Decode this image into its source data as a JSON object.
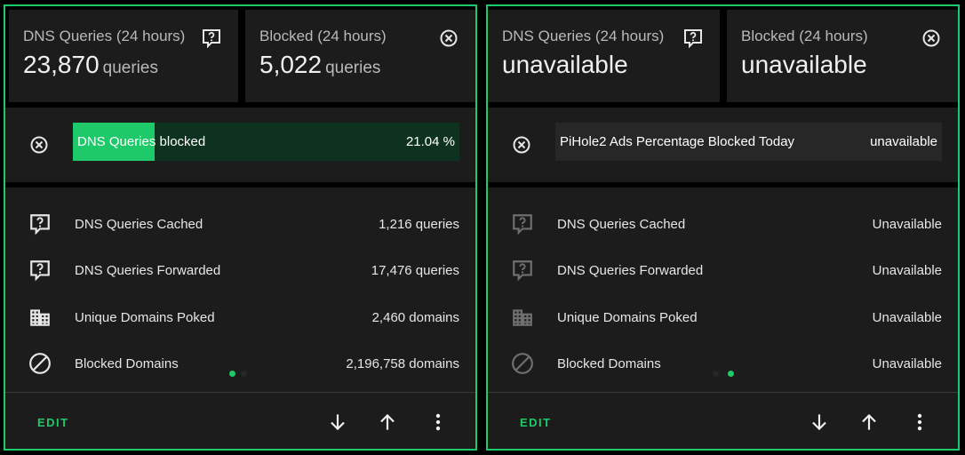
{
  "accent": "#1ec96a",
  "cards": [
    {
      "queries_label": "DNS Queries (24 hours)",
      "queries_value": "23,870",
      "queries_unit": "queries",
      "blocked_label": "Blocked (24 hours)",
      "blocked_value": "5,022",
      "blocked_unit": "queries",
      "bar_text": "DNS Queries blocked",
      "bar_value": "21.04 %",
      "bar_fraction": 0.2104,
      "rows": [
        {
          "label": "DNS Queries Cached",
          "value": "1,216 queries",
          "icon": "comment-question-icon"
        },
        {
          "label": "DNS Queries Forwarded",
          "value": "17,476 queries",
          "icon": "comment-question-icon"
        },
        {
          "label": "Unique Domains Poked",
          "value": "2,460 domains",
          "icon": "domain-icon"
        },
        {
          "label": "Blocked Domains",
          "value": "2,196,758 domains",
          "icon": "cancel-icon"
        }
      ],
      "active_page": 1,
      "edit_label": "EDIT"
    },
    {
      "queries_label": "DNS Queries (24 hours)",
      "queries_value": "unavailable",
      "blocked_label": "Blocked (24 hours)",
      "blocked_value": "unavailable",
      "bar_text": "PiHole2 Ads Percentage Blocked Today",
      "bar_value": "unavailable",
      "rows": [
        {
          "label": "DNS Queries Cached",
          "value": "Unavailable",
          "icon": "comment-question-icon"
        },
        {
          "label": "DNS Queries Forwarded",
          "value": "Unavailable",
          "icon": "comment-question-icon"
        },
        {
          "label": "Unique Domains Poked",
          "value": "Unavailable",
          "icon": "domain-icon"
        },
        {
          "label": "Blocked Domains",
          "value": "Unavailable",
          "icon": "cancel-icon"
        }
      ],
      "active_page": 2,
      "edit_label": "EDIT"
    }
  ]
}
